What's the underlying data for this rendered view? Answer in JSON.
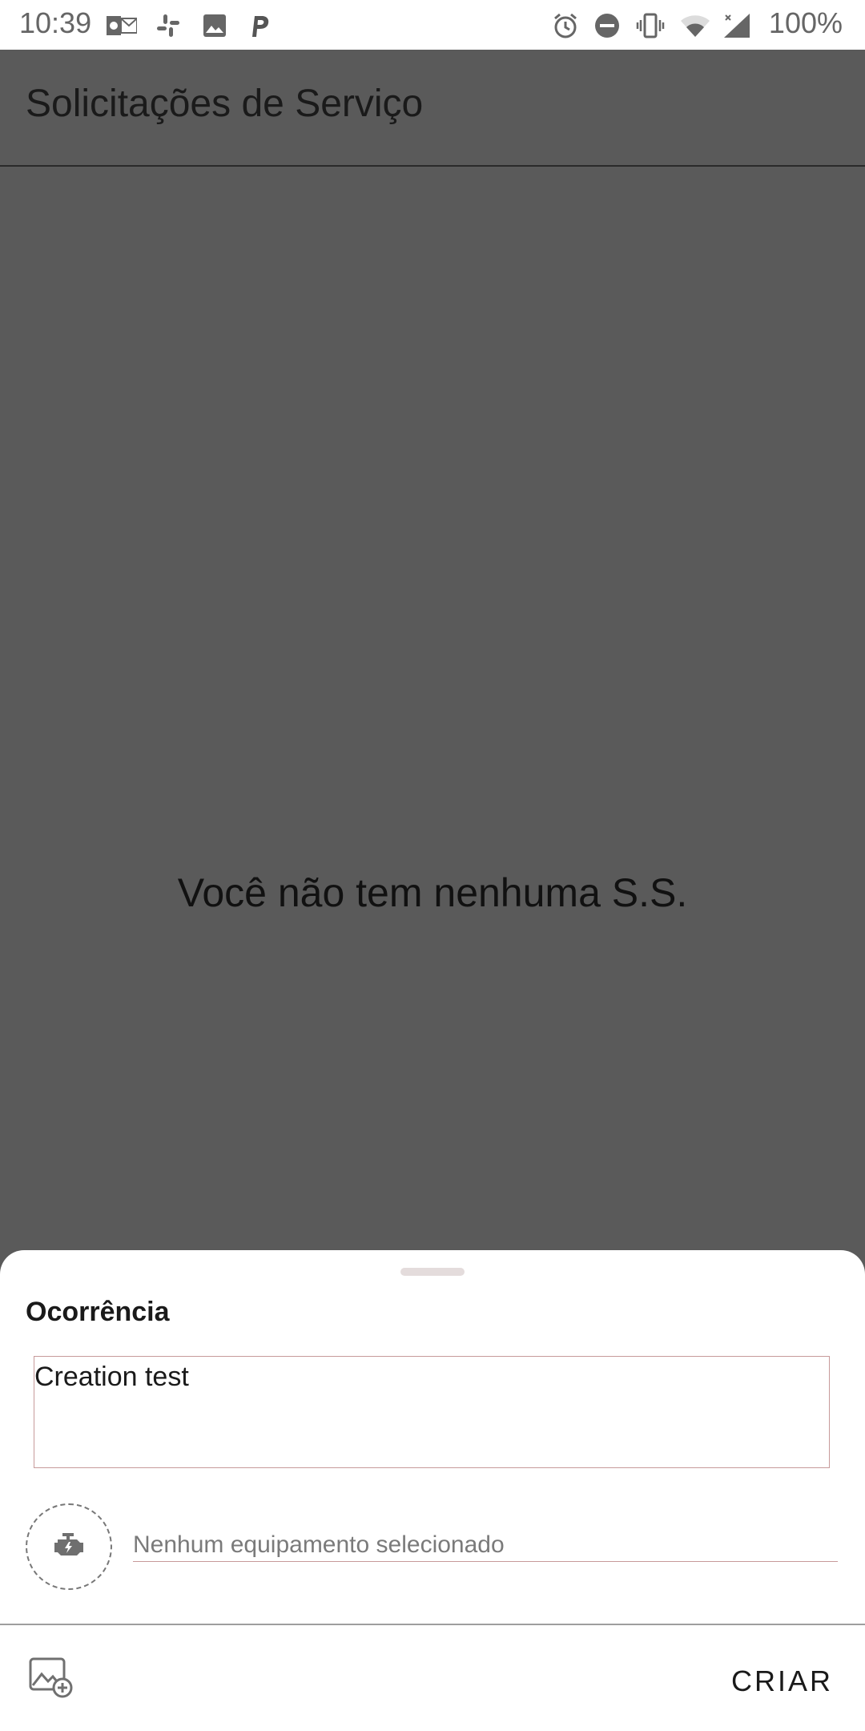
{
  "status_bar": {
    "time": "10:39",
    "battery": "100%",
    "icons": [
      "outlook-icon",
      "slack-icon",
      "image-icon",
      "p-icon",
      "alarm-icon",
      "dnd-icon",
      "vibrate-icon",
      "wifi-icon",
      "signal-icon"
    ]
  },
  "header": {
    "title": "Solicitações de Serviço"
  },
  "main": {
    "empty_message": "Você não tem nenhuma S.S."
  },
  "sheet": {
    "occurrence_label": "Ocorrência",
    "occurrence_value": "Creation test",
    "equipment_placeholder": "Nenhum equipamento selecionado",
    "create_label": "CRIAR"
  },
  "colors": {
    "scrim": "#5a5a5a",
    "sheet": "#ffffff",
    "text": "#1a1a1a"
  }
}
